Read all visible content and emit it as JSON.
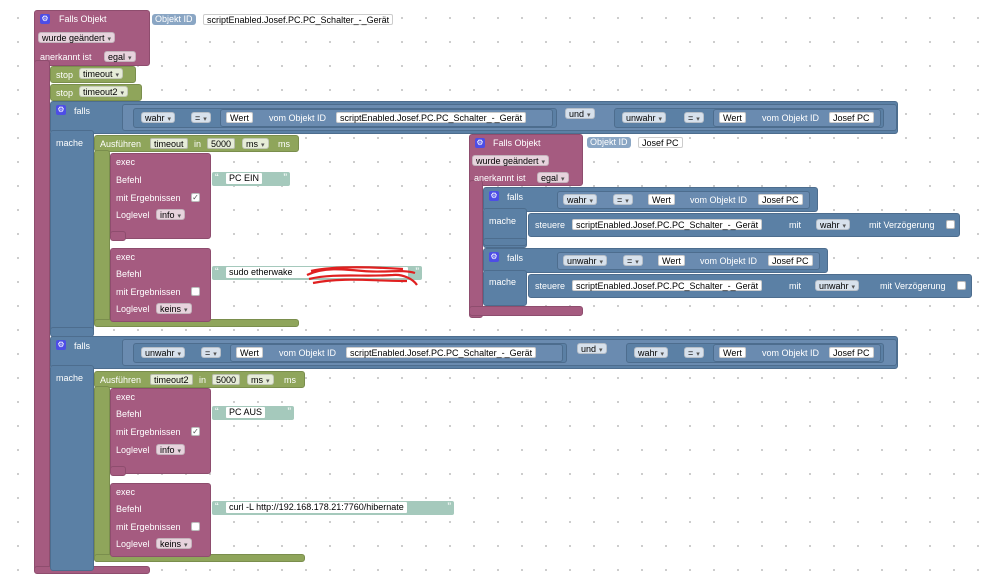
{
  "main_trigger": {
    "falls_objekt": "Falls Objekt",
    "objekt_id_label": "Objekt ID",
    "objekt_id_value": "scriptEnabled.Josef.PC.PC_Schalter_-_Gerät",
    "wurde_geaendert": "wurde geändert",
    "anerkannt_ist": "anerkannt ist",
    "egal": "egal"
  },
  "stops": [
    {
      "label": "stop",
      "value": "timeout"
    },
    {
      "label": "stop",
      "value": "timeout2"
    }
  ],
  "falls1": {
    "falls": "falls",
    "mache": "mache",
    "cond1": {
      "left": "wahr",
      "op": "=",
      "wert": "Wert",
      "vom": "vom Objekt ID",
      "id": "scriptEnabled.Josef.PC.PC_Schalter_-_Gerät"
    },
    "und": "und",
    "cond2": {
      "left": "unwahr",
      "op": "=",
      "wert": "Wert",
      "vom": "vom Objekt ID",
      "id": "Josef PC"
    },
    "ausfuehren": {
      "label": "Ausführen",
      "name": "timeout",
      "in": "in",
      "value": "5000",
      "unit": "ms",
      "unit2": "ms"
    },
    "exec1": {
      "exec": "exec",
      "befehl": "Befehl",
      "befehl_value": "PC EIN",
      "mit": "mit Ergebnissen",
      "mit_checked": "✓",
      "loglevel": "Loglevel",
      "loglevel_value": "info"
    },
    "exec2": {
      "exec": "exec",
      "befehl": "Befehl",
      "befehl_value": "sudo etherwake",
      "mit": "mit Ergebnissen",
      "loglevel": "Loglevel",
      "loglevel_value": "keins"
    }
  },
  "inner_trigger": {
    "falls_objekt": "Falls Objekt",
    "objekt_id_label": "Objekt ID",
    "objekt_id_value": "Josef PC",
    "wurde_geaendert": "wurde geändert",
    "anerkannt_ist": "anerkannt ist",
    "egal": "egal",
    "falls_a": {
      "falls": "falls",
      "mache": "mache",
      "cond": {
        "left": "wahr",
        "op": "=",
        "wert": "Wert",
        "vom": "vom Objekt ID",
        "id": "Josef PC"
      },
      "steuere": "steuere",
      "target": "scriptEnabled.Josef.PC.PC_Schalter_-_Gerät",
      "mit": "mit",
      "value": "wahr",
      "verz": "mit Verzögerung"
    },
    "falls_b": {
      "falls": "falls",
      "mache": "mache",
      "cond": {
        "left": "unwahr",
        "op": "=",
        "wert": "Wert",
        "vom": "vom Objekt ID",
        "id": "Josef PC"
      },
      "steuere": "steuere",
      "target": "scriptEnabled.Josef.PC.PC_Schalter_-_Gerät",
      "mit": "mit",
      "value": "unwahr",
      "verz": "mit Verzögerung"
    }
  },
  "falls2": {
    "falls": "falls",
    "mache": "mache",
    "cond1": {
      "left": "unwahr",
      "op": "=",
      "wert": "Wert",
      "vom": "vom Objekt ID",
      "id": "scriptEnabled.Josef.PC.PC_Schalter_-_Gerät"
    },
    "und": "und",
    "cond2": {
      "left": "wahr",
      "op": "=",
      "wert": "Wert",
      "vom": "vom Objekt ID",
      "id": "Josef PC"
    },
    "ausfuehren": {
      "label": "Ausführen",
      "name": "timeout2",
      "in": "in",
      "value": "5000",
      "unit": "ms",
      "unit2": "ms"
    },
    "exec1": {
      "exec": "exec",
      "befehl": "Befehl",
      "befehl_value": "PC AUS",
      "mit": "mit Ergebnissen",
      "mit_checked": "✓",
      "loglevel": "Loglevel",
      "loglevel_value": "info"
    },
    "exec2": {
      "exec": "exec",
      "befehl": "Befehl",
      "befehl_value": "curl -L http://192.168.178.21:7760/hibernate",
      "mit": "mit Ergebnissen",
      "loglevel": "Loglevel",
      "loglevel_value": "keins"
    }
  },
  "icons": {
    "gear": "gear-icon",
    "caret": "▾",
    "quote_open": "“",
    "quote_close": "”"
  },
  "colors": {
    "event": "#a55b80",
    "logic": "#5b80a5",
    "timer": "#8fa55b",
    "string": "#a5c9bc"
  }
}
